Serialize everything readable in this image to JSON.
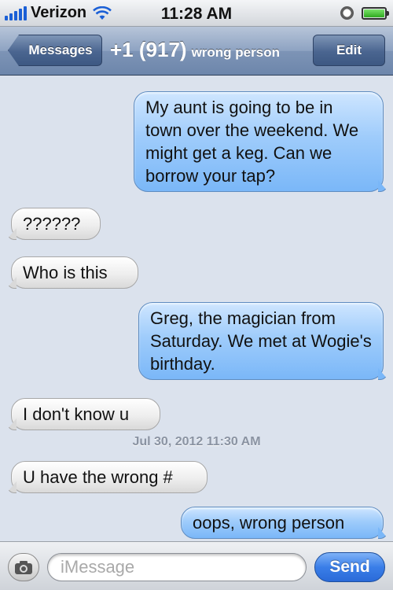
{
  "status_bar": {
    "carrier": "Verizon",
    "time": "11:28 AM",
    "signal_bars": 5,
    "battery_level": 1.0,
    "icons": [
      "signal-icon",
      "wifi-icon",
      "alarm-icon",
      "battery-icon"
    ]
  },
  "nav": {
    "back_label": "Messages",
    "title_number": "+1 (917)",
    "title_name": "wrong person",
    "edit_label": "Edit"
  },
  "thread": {
    "messages": [
      {
        "direction": "outgoing",
        "text": "My aunt is going to be in town over the weekend. We might get a keg. Can we borrow your tap?"
      },
      {
        "direction": "incoming",
        "text": "??????"
      },
      {
        "direction": "incoming",
        "text": "Who is this"
      },
      {
        "direction": "outgoing",
        "text": "Greg, the magician from Saturday. We met at Wogie's birthday."
      },
      {
        "direction": "incoming",
        "text": "I don't know u"
      },
      {
        "direction": "incoming",
        "text": "U have the wrong #"
      },
      {
        "direction": "outgoing",
        "text": "oops, wrong person"
      }
    ],
    "timestamp": "Jul 30, 2012 11:30 AM"
  },
  "composer": {
    "placeholder": "iMessage",
    "value": "",
    "send_label": "Send"
  },
  "colors": {
    "background": "#dbe2ed",
    "outgoing_bubble": "#9fccfb",
    "incoming_bubble": "#eeeeee",
    "send_button": "#3a7ee8"
  }
}
